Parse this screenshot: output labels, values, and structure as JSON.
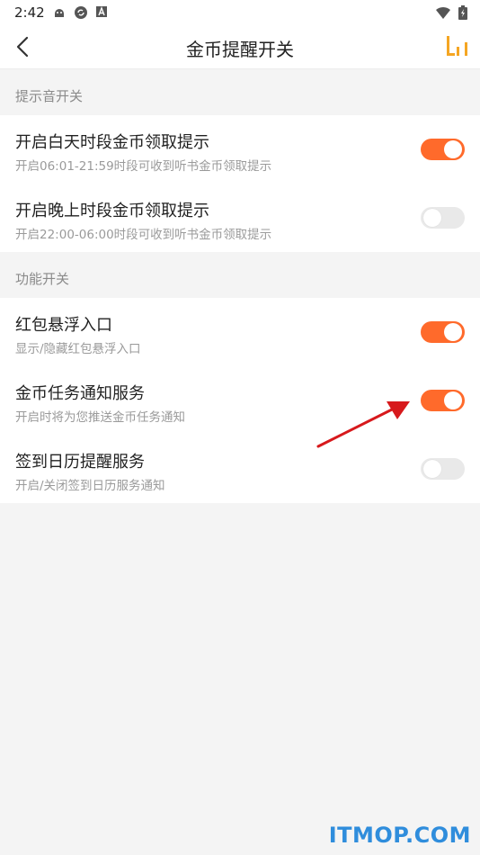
{
  "status_bar": {
    "time": "2:42",
    "icons": [
      "android-icon",
      "sync-icon",
      "notification-a-icon",
      "wifi-icon",
      "battery-icon"
    ]
  },
  "navbar": {
    "title": "金币提醒开关",
    "back_icon": "chevron-left-icon",
    "stats_icon": "bar-chart-icon"
  },
  "colors": {
    "accent": "#ff6a2b",
    "toggle_off": "#e9e9e9",
    "annotation_arrow": "#d7191c",
    "watermark": "#2f8ddc"
  },
  "sections": [
    {
      "header": "提示音开关",
      "rows": [
        {
          "title": "开启白天时段金币领取提示",
          "subtitle": "开启06:01-21:59时段可收到听书金币领取提示",
          "on": true
        },
        {
          "title": "开启晚上时段金币领取提示",
          "subtitle": "开启22:00-06:00时段可收到听书金币领取提示",
          "on": false
        }
      ]
    },
    {
      "header": "功能开关",
      "rows": [
        {
          "title": "红包悬浮入口",
          "subtitle": "显示/隐藏红包悬浮入口",
          "on": true
        },
        {
          "title": "金币任务通知服务",
          "subtitle": "开启时将为您推送金币任务通知",
          "on": true
        },
        {
          "title": "签到日历提醒服务",
          "subtitle": "开启/关闭签到日历服务通知",
          "on": false
        }
      ]
    }
  ],
  "watermark": "ITMOP.COM"
}
